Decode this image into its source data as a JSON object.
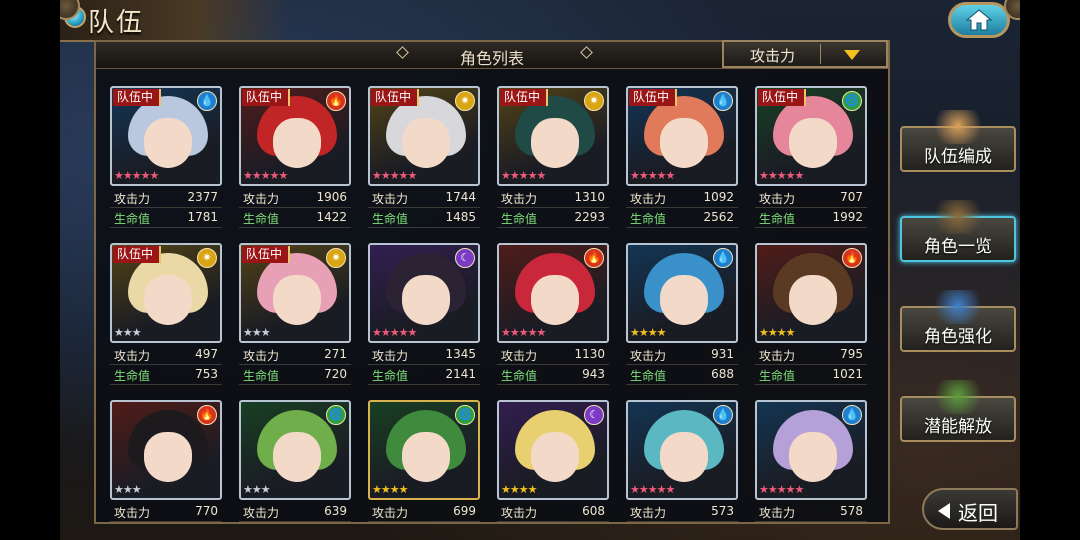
{
  "header": {
    "title": "队伍",
    "home_icon": "home-icon"
  },
  "panel": {
    "title": "角色列表",
    "sort_label": "攻击力",
    "sort_dropdown_icon": "triangle-down-icon"
  },
  "labels": {
    "team_tag": "队伍中",
    "atk": "攻击力",
    "hp": "生命值"
  },
  "element_colors": {
    "water": "#1e7fd1",
    "fire": "#d6341f",
    "light": "#d9a514",
    "wind": "#2e9f3e",
    "dark": "#7b3bc4"
  },
  "element_glyphs": {
    "water": "💧",
    "fire": "🔥",
    "light": "✷",
    "wind": "🌀",
    "dark": "☾"
  },
  "characters": [
    {
      "in_team": true,
      "element": "water",
      "stars": 5,
      "atk": "2377",
      "hp": "1781",
      "hair": "#b9c8de"
    },
    {
      "in_team": true,
      "element": "fire",
      "stars": 5,
      "atk": "1906",
      "hp": "1422",
      "hair": "#c22525"
    },
    {
      "in_team": true,
      "element": "light",
      "stars": 5,
      "atk": "1744",
      "hp": "1485",
      "hair": "#d8d8dc"
    },
    {
      "in_team": true,
      "element": "light",
      "stars": 5,
      "atk": "1310",
      "hp": "2293",
      "hair": "#1f4a45"
    },
    {
      "in_team": true,
      "element": "water",
      "stars": 5,
      "atk": "1092",
      "hp": "2562",
      "hair": "#e07a5a"
    },
    {
      "in_team": true,
      "element": "wind",
      "stars": 5,
      "atk": "707",
      "hp": "1992",
      "hair": "#e6869a"
    },
    {
      "in_team": true,
      "element": "light",
      "stars": 3,
      "atk": "497",
      "hp": "753",
      "hair": "#ead9a6"
    },
    {
      "in_team": true,
      "element": "light",
      "stars": 3,
      "atk": "271",
      "hp": "720",
      "hair": "#e8a0b6"
    },
    {
      "in_team": false,
      "element": "dark",
      "stars": 5,
      "atk": "1345",
      "hp": "2141",
      "hair": "#2b2233"
    },
    {
      "in_team": false,
      "element": "fire",
      "stars": 5,
      "atk": "1130",
      "hp": "943",
      "hair": "#c8283a"
    },
    {
      "in_team": false,
      "element": "water",
      "stars": 4,
      "atk": "931",
      "hp": "688",
      "hair": "#3a90c8"
    },
    {
      "in_team": false,
      "element": "fire",
      "stars": 4,
      "atk": "795",
      "hp": "1021",
      "hair": "#5b3a24"
    },
    {
      "in_team": false,
      "element": "fire",
      "stars": 3,
      "atk": "770",
      "hp": "",
      "hair": "#1c1a1c"
    },
    {
      "in_team": false,
      "element": "wind",
      "stars": 3,
      "atk": "639",
      "hp": "",
      "hair": "#6fae4a"
    },
    {
      "in_team": false,
      "element": "wind",
      "stars": 4,
      "atk": "699",
      "hp": "",
      "hair": "#3f8a3c",
      "gold": true
    },
    {
      "in_team": false,
      "element": "dark",
      "stars": 4,
      "atk": "608",
      "hp": "",
      "hair": "#e8d070"
    },
    {
      "in_team": false,
      "element": "water",
      "stars": 5,
      "atk": "573",
      "hp": "",
      "hair": "#5bb8c2"
    },
    {
      "in_team": false,
      "element": "water",
      "stars": 5,
      "atk": "578",
      "hp": "",
      "hair": "#b5a0d8"
    }
  ],
  "side_menu": [
    {
      "label": "队伍编成",
      "icon": "team-portraits-icon",
      "active": false
    },
    {
      "label": "角色一览",
      "icon": "book-icon",
      "active": true
    },
    {
      "label": "角色强化",
      "icon": "upgrade-card-icon",
      "active": false
    },
    {
      "label": "潜能解放",
      "icon": "potential-orb-icon",
      "active": false
    }
  ],
  "back_button": {
    "label": "返回",
    "icon": "back-arrow-icon"
  }
}
